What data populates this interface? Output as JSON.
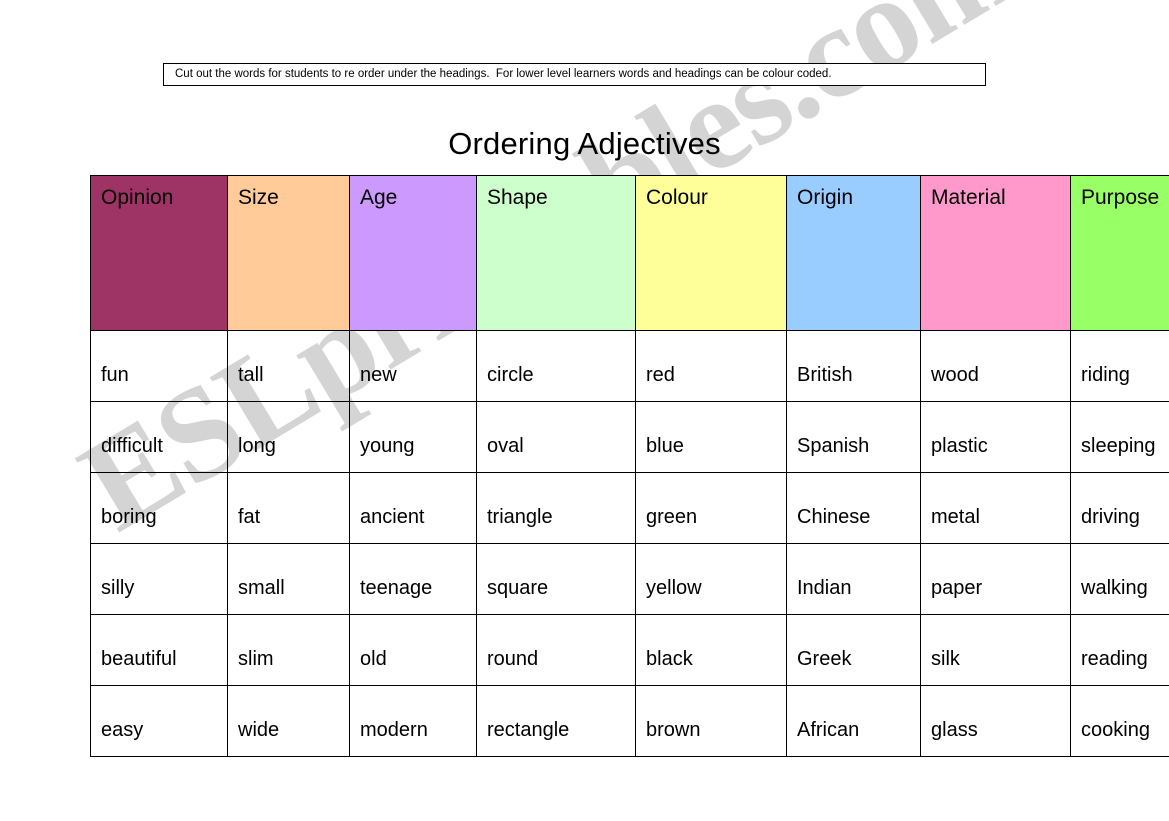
{
  "instruction": {
    "text": "Cut out the words for students to re order under the headings.  For lower level learners words and headings can be colour coded."
  },
  "title": "Ordering Adjectives",
  "watermark": {
    "text": "ESLprintables.com"
  },
  "table": {
    "headers": [
      {
        "label": "Opinion",
        "color": "#9E3466"
      },
      {
        "label": "Size",
        "color": "#FFCC99"
      },
      {
        "label": "Age",
        "color": "#CC99FF"
      },
      {
        "label": "Shape",
        "color": "#CCFFCC"
      },
      {
        "label": "Colour",
        "color": "#FFFF99"
      },
      {
        "label": "Origin",
        "color": "#99CCFF"
      },
      {
        "label": "Material",
        "color": "#FF99CC"
      },
      {
        "label": "Purpose",
        "color": "#99FF66"
      }
    ],
    "rows": [
      [
        "fun",
        "tall",
        "new",
        "circle",
        "red",
        "British",
        "wood",
        "riding"
      ],
      [
        "difficult",
        "long",
        "young",
        "oval",
        "blue",
        "Spanish",
        "plastic",
        "sleeping"
      ],
      [
        "boring",
        "fat",
        "ancient",
        "triangle",
        "green",
        "Chinese",
        "metal",
        "driving"
      ],
      [
        "silly",
        "small",
        "teenage",
        "square",
        "yellow",
        "Indian",
        "paper",
        "walking"
      ],
      [
        "beautiful",
        "slim",
        "old",
        "round",
        "black",
        "Greek",
        "silk",
        "reading"
      ],
      [
        "easy",
        "wide",
        "modern",
        "rectangle",
        "brown",
        "African",
        "glass",
        "cooking"
      ]
    ]
  }
}
